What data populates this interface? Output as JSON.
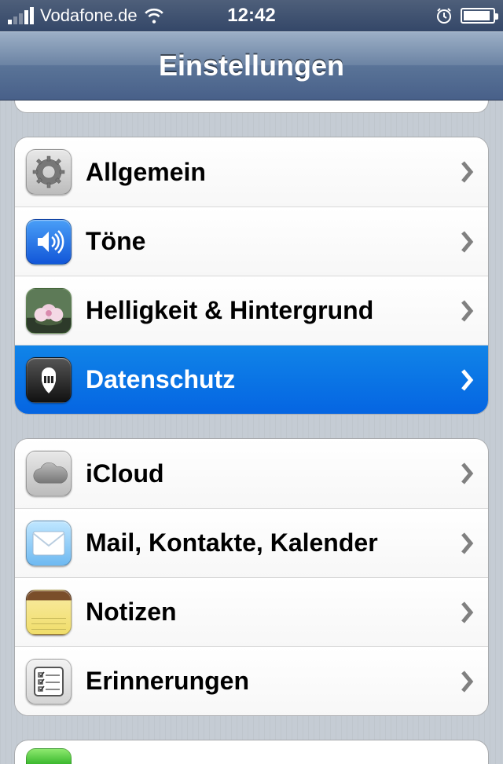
{
  "status_bar": {
    "carrier": "Vodafone.de",
    "time": "12:42"
  },
  "nav": {
    "title": "Einstellungen"
  },
  "group1": [
    {
      "label": "Allgemein"
    },
    {
      "label": "Töne"
    },
    {
      "label": "Helligkeit & Hintergrund"
    },
    {
      "label": "Datenschutz"
    }
  ],
  "group2": [
    {
      "label": "iCloud"
    },
    {
      "label": "Mail, Kontakte, Kalender"
    },
    {
      "label": "Notizen"
    },
    {
      "label": "Erinnerungen"
    }
  ]
}
